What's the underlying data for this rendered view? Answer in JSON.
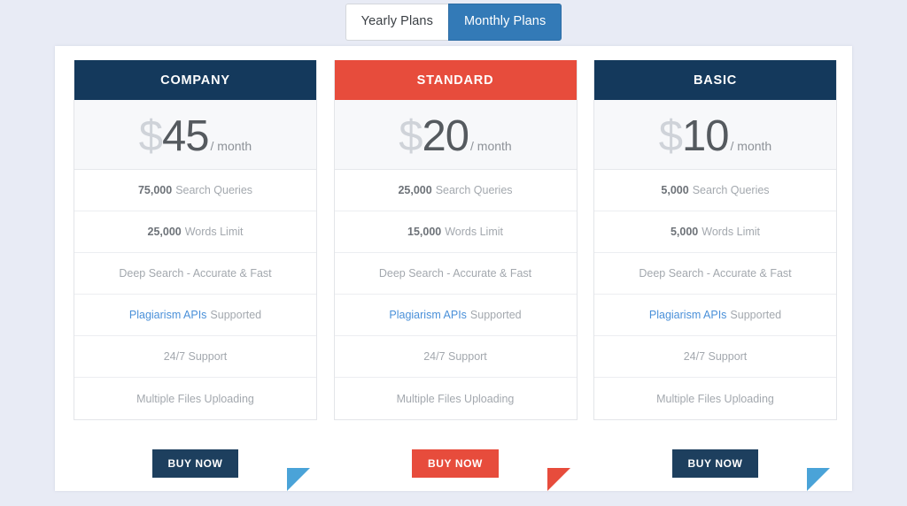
{
  "toggle": {
    "yearly_label": "Yearly Plans",
    "monthly_label": "Monthly Plans",
    "active": "Monthly Plans"
  },
  "colors": {
    "page_background": "#e8ebf5",
    "dark_navy": "#14395c",
    "red": "#e74c3c",
    "active_toggle_blue": "#337ab7",
    "link_blue": "#4a90d9",
    "triangle_blue": "#4aa3d8"
  },
  "plans": [
    {
      "name": "COMPANY",
      "theme": "dark",
      "currency": "$",
      "amount": "45",
      "period": "/ month",
      "features": [
        {
          "strong": "75,000",
          "text": "Search Queries"
        },
        {
          "strong": "25,000",
          "text": "Words Limit"
        },
        {
          "text": "Deep Search - Accurate & Fast"
        },
        {
          "link": "Plagiarism APIs",
          "text": "Supported"
        },
        {
          "text": "24/7 Support"
        },
        {
          "text": "Multiple Files Uploading"
        }
      ],
      "buy_label": "BUY NOW",
      "triangle_color": "blue"
    },
    {
      "name": "STANDARD",
      "theme": "red",
      "currency": "$",
      "amount": "20",
      "period": "/ month",
      "features": [
        {
          "strong": "25,000",
          "text": "Search Queries"
        },
        {
          "strong": "15,000",
          "text": "Words Limit"
        },
        {
          "text": "Deep Search - Accurate & Fast"
        },
        {
          "link": "Plagiarism APIs",
          "text": "Supported"
        },
        {
          "text": "24/7 Support"
        },
        {
          "text": "Multiple Files Uploading"
        }
      ],
      "buy_label": "BUY NOW",
      "triangle_color": "red"
    },
    {
      "name": "BASIC",
      "theme": "dark",
      "currency": "$",
      "amount": "10",
      "period": "/ month",
      "features": [
        {
          "strong": "5,000",
          "text": "Search Queries"
        },
        {
          "strong": "5,000",
          "text": "Words Limit"
        },
        {
          "text": "Deep Search - Accurate & Fast"
        },
        {
          "link": "Plagiarism APIs",
          "text": "Supported"
        },
        {
          "text": "24/7 Support"
        },
        {
          "text": "Multiple Files Uploading"
        }
      ],
      "buy_label": "BUY NOW",
      "triangle_color": "blue"
    }
  ]
}
